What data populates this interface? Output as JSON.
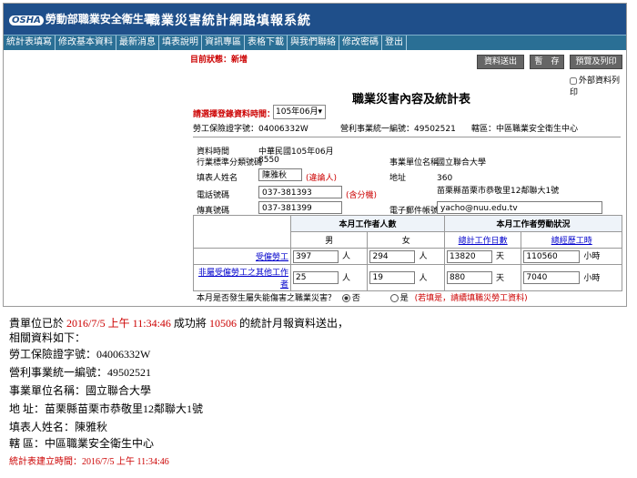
{
  "banner": {
    "agency": "勞動部職業安全衛生署",
    "logo_mark": "OSHA",
    "system_title": "職業災害統計網路填報系統"
  },
  "menu": [
    "統計表填寫",
    "修改基本資料",
    "最新消息",
    "填表說明",
    "資訊專區",
    "表格下載",
    "與我們聯絡",
    "修改密碼",
    "登出"
  ],
  "status": "目前狀態：新增",
  "buttons": {
    "send": "資料送出",
    "pause": "暫　存",
    "preview": "預覽及列印"
  },
  "external_print": "外部資料列印",
  "form_title": "職業災害內容及統計表",
  "period": {
    "label": "請選擇登錄資料時間：",
    "value": "105年06月"
  },
  "ids": {
    "insurance_label": "勞工保險證字號：",
    "insurance_value": "04006332W",
    "uniform_label": "營利事業統一編號：",
    "uniform_value": "49502521",
    "region_label": "轄區：",
    "region_value": "中區職業安全衛生中心"
  },
  "details": {
    "time_label": "資料時間",
    "time_value": "中華民國105年06月",
    "industry_label": "行業標準分類號碼",
    "industry_value": "8550",
    "unit_label": "事業單位名稱",
    "unit_value": "國立聯合大學",
    "filler_label": "填表人姓名",
    "filler_value": "陳雅秋",
    "filler_note": "(違論人)",
    "address_label": "地址",
    "address_code": "360",
    "address_value": "苗栗縣苗栗市恭敬里12鄰聯大1號",
    "phone_label": "電話號碼",
    "phone_value": "037-381393",
    "phone_note": "(含分機)",
    "fax_label": "傳真號碼",
    "fax_value": "037-381399",
    "email_label": "電子郵件帳號",
    "email_value": "yacho@nuu.edu.tv"
  },
  "table": {
    "h_workers": "本月工作者人數",
    "h_hours": "本月工作者勞動狀況",
    "male": "男",
    "female": "女",
    "days": "總計工作日數",
    "hours": "總經歷工時",
    "rows": [
      {
        "label": "受僱勞工",
        "male": "397",
        "female": "294",
        "days": "13820",
        "hours": "110560"
      },
      {
        "label": "非屬受僱勞工之其他工作者",
        "male": "25",
        "female": "19",
        "days": "880",
        "hours": "7040"
      }
    ],
    "unit_person": "人",
    "unit_day": "天",
    "unit_hour": "小時"
  },
  "question": {
    "text": "本月是否發生屬失能傷害之職業災害？",
    "no": "否",
    "yes": "是",
    "note": "(若填是，請續填職災勞工資料)"
  },
  "message": {
    "line1_a": "貴單位已於",
    "line1_time": "2016/7/5 上午 11:34:46",
    "line1_b": "成功將",
    "line1_id": "10506",
    "line1_c": "的統計月報資料送出，",
    "line2": "相關資料如下：",
    "line3": "勞工保險證字號：04006332W",
    "line4": "營利事業統一編號：49502521",
    "line5": "事業單位名稱：國立聯合大學",
    "line6": "地 址：苗栗縣苗栗市恭敬里12鄰聯大1號",
    "line7": "填表人姓名：陳雅秋",
    "line8": "轄 區：中區職業安全衛生中心",
    "line9": "統計表建立時間：2016/7/5 上午 11:34:46"
  }
}
